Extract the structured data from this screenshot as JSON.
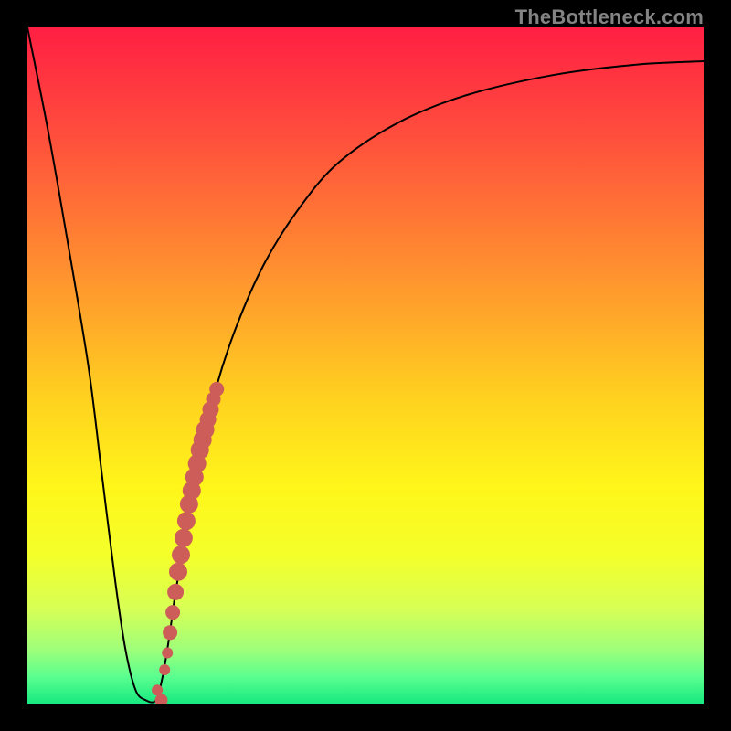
{
  "watermark": "TheBottleneck.com",
  "colors": {
    "frame": "#000000",
    "curve": "#000000",
    "marker_fill": "#cd5d58",
    "gradient_stops": [
      {
        "offset": 0.0,
        "color": "#ff1f43"
      },
      {
        "offset": 0.15,
        "color": "#ff4b3d"
      },
      {
        "offset": 0.35,
        "color": "#ff8d30"
      },
      {
        "offset": 0.55,
        "color": "#ffd21f"
      },
      {
        "offset": 0.68,
        "color": "#fff61a"
      },
      {
        "offset": 0.78,
        "color": "#f4ff2a"
      },
      {
        "offset": 0.86,
        "color": "#d7ff55"
      },
      {
        "offset": 0.92,
        "color": "#9fff7a"
      },
      {
        "offset": 0.96,
        "color": "#5bff8f"
      },
      {
        "offset": 1.0,
        "color": "#16e97f"
      }
    ]
  },
  "chart_data": {
    "type": "line",
    "title": "",
    "xlabel": "",
    "ylabel": "",
    "xlim": [
      0,
      100
    ],
    "ylim": [
      0,
      100
    ],
    "series": [
      {
        "name": "bottleneck-curve",
        "x": [
          0,
          3,
          6,
          9,
          11,
          13,
          14.5,
          16,
          17.5,
          19,
          20,
          21,
          22,
          24,
          26,
          28,
          31,
          35,
          40,
          46,
          55,
          65,
          78,
          90,
          100
        ],
        "y": [
          100,
          85,
          68,
          50,
          34,
          18,
          8,
          2,
          0.5,
          0.5,
          4,
          10,
          17,
          28,
          38,
          47,
          56,
          65,
          73,
          80,
          86,
          90,
          93,
          94.5,
          95
        ]
      }
    ],
    "markers": {
      "name": "highlight-points",
      "x": [
        19.2,
        19.8,
        20.3,
        20.7,
        21.1,
        21.5,
        21.9,
        22.3,
        22.7,
        23.1,
        23.5,
        23.9,
        24.3,
        24.7,
        25.1,
        25.5,
        25.9,
        26.3,
        26.7,
        27.1,
        27.5,
        28.0
      ],
      "y": [
        2.0,
        0.5,
        5.0,
        7.5,
        10.5,
        13.5,
        16.5,
        19.5,
        22.0,
        24.5,
        27.0,
        29.5,
        31.5,
        33.5,
        35.5,
        37.5,
        39.0,
        40.5,
        42.0,
        43.5,
        45.0,
        46.5
      ],
      "r": [
        6,
        7,
        6,
        6,
        8,
        8,
        9,
        10,
        10,
        10,
        10,
        10,
        10,
        10,
        10,
        10,
        10,
        10,
        9,
        9,
        8,
        8
      ]
    }
  }
}
